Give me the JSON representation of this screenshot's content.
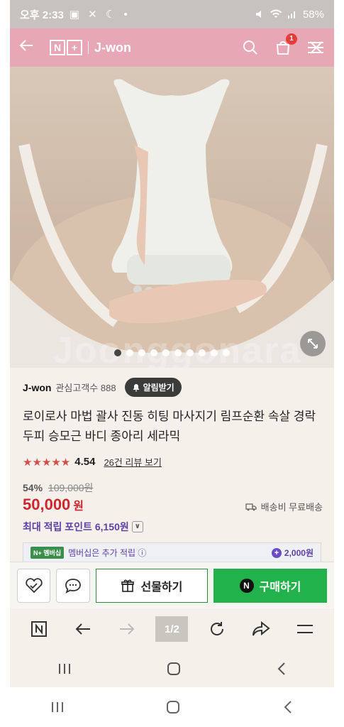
{
  "status_bar": {
    "time": "오후 2:33",
    "left_icons": "▣ ✕ ☾ •",
    "battery": "58%"
  },
  "header": {
    "logo_n": "N",
    "logo_plus": "+",
    "store_name": "J-won",
    "cart_count": "1",
    "bg_color": "#e7a7b4"
  },
  "hero": {
    "watermark": "Joonggonara",
    "dot_count": 10,
    "active_dot": 0
  },
  "seller": {
    "name": "J-won",
    "fans": "관심고객수 888",
    "alarm_label": "알림받기"
  },
  "product": {
    "title": "로이로사 마법 괄사 진동 히팅 마사지기 림프순환 속살 경락두피 승모근 바디 종아리 세라믹",
    "stars": "★★★★★",
    "rating": "4.54",
    "review_link": "26건 리뷰 보기",
    "discount_pct": "54%",
    "original_price": "109,000원",
    "price": "50,000",
    "price_unit": "원",
    "shipping": "배송비 무료배송",
    "points": "최대 적립 포인트 6,150원",
    "points_chevron": "∨"
  },
  "member": {
    "badge": "N+ 멤버십",
    "text": "멤버십은 추가 적립 ⓘ",
    "amount": "2,000원"
  },
  "actions": {
    "gift_label": "선물하기",
    "buy_label": "구매하기",
    "buy_n": "N"
  },
  "browser": {
    "tab_count": "1/2"
  },
  "colors": {
    "accent_green": "#22b24c",
    "price_red": "#d0252f",
    "points_purple": "#5d3fa5"
  }
}
